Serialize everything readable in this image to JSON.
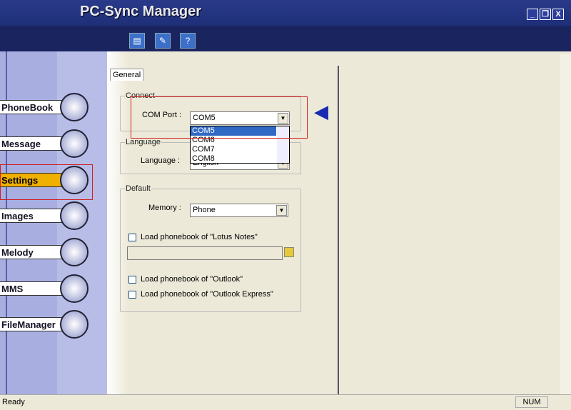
{
  "window": {
    "title": "PC-Sync Manager",
    "minimize": "_",
    "restore": "❐",
    "close": "X"
  },
  "toolbar": [
    {
      "icon": "document-icon",
      "glyph": "▤"
    },
    {
      "icon": "edit-icon",
      "glyph": "✎"
    },
    {
      "icon": "help-icon",
      "glyph": "?"
    }
  ],
  "sidebar": {
    "items": [
      {
        "label": "PhoneBook",
        "icon": "phone-icon",
        "glyph": "📱"
      },
      {
        "label": "Message",
        "icon": "envelope-icon",
        "glyph": "✉"
      },
      {
        "label": "Settings",
        "icon": "settings-icon",
        "glyph": "⚙",
        "selected": true
      },
      {
        "label": "Images",
        "icon": "images-icon",
        "glyph": "▦"
      },
      {
        "label": "Melody",
        "icon": "music-icon",
        "glyph": "♪"
      },
      {
        "label": "MMS",
        "icon": "balloon-icon",
        "glyph": "●"
      },
      {
        "label": "FileManager",
        "icon": "folder-icon",
        "glyph": "▰"
      }
    ]
  },
  "main": {
    "tab": "General",
    "connect": {
      "title": "Connect",
      "com_label": "COM Port :",
      "com_value": "COM5",
      "options": [
        "COM5",
        "COM6",
        "COM7",
        "COM8"
      ]
    },
    "language": {
      "title": "Language",
      "label": "Language :",
      "value": "English"
    },
    "default": {
      "title": "Default",
      "memory_label": "Memory :",
      "memory_value": "Phone",
      "lotus": "Load phonebook of \"Lotus Notes\"",
      "outlook": "Load phonebook of \"Outlook\"",
      "outlook_express": "Load phonebook of \"Outlook Express\"",
      "path_value": ""
    }
  },
  "status": {
    "text": "Ready",
    "num": "NUM"
  },
  "colors": {
    "title_bar": "#1e2f78",
    "highlight": "#316ac5",
    "annotation": "#d02020"
  }
}
